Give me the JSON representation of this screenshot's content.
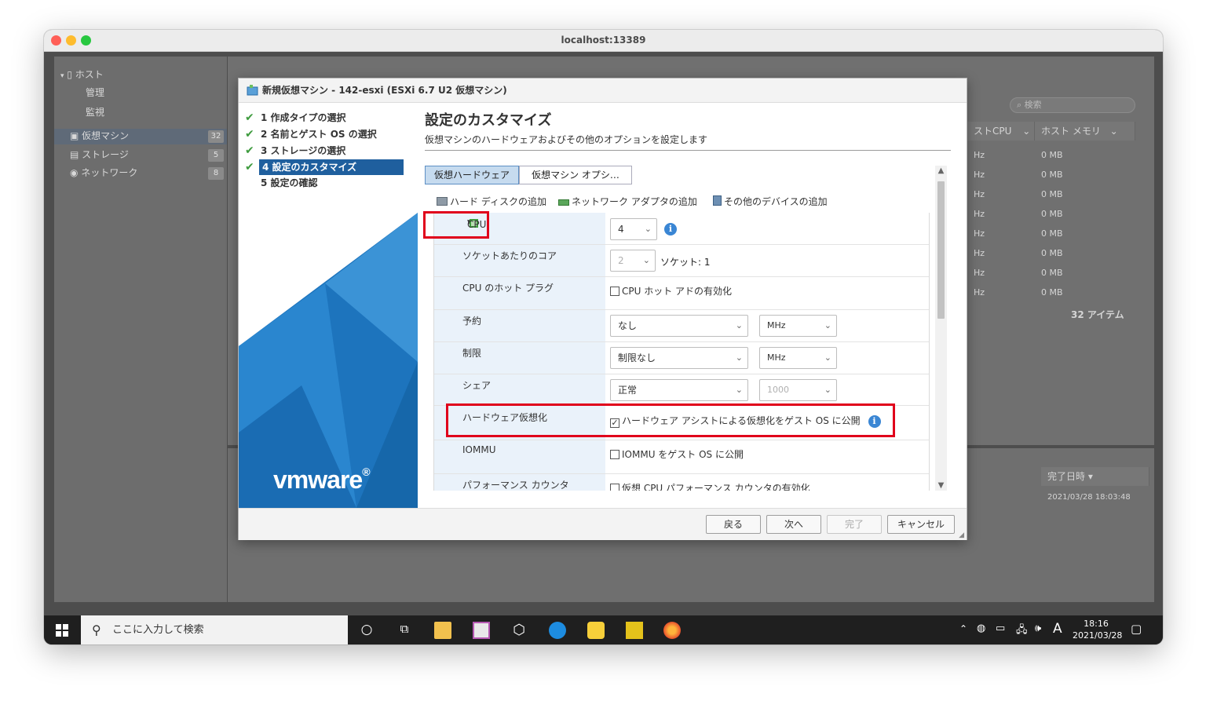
{
  "window": {
    "url": "localhost:13389"
  },
  "background_app": {
    "nav": {
      "host": "ホスト",
      "manage": "管理",
      "monitor": "監視",
      "vms": "仮想マシン",
      "vms_count": "32",
      "storage": "ストレージ",
      "storage_count": "5",
      "network": "ネットワーク",
      "network_count": "8"
    },
    "search_placeholder": "検索",
    "grid": {
      "col_cpu": "ストCPU",
      "col_mem": "ホスト メモリ",
      "cpu_values": [
        "Hz",
        "Hz",
        "Hz",
        "Hz",
        "Hz",
        "Hz",
        "Hz",
        "Hz"
      ],
      "mem_values": [
        "0 MB",
        "0 MB",
        "0 MB",
        "0 MB",
        "0 MB",
        "0 MB",
        "0 MB",
        "0 MB"
      ],
      "item_count": "32 アイテム"
    },
    "tasks": {
      "col_completed": "完了日時 ▾",
      "completed_value": "2021/03/28 18:03:48"
    }
  },
  "dialog": {
    "title": "新規仮想マシン - 142-esxi (ESXi 6.7 U2 仮想マシン)",
    "steps": [
      {
        "label": "1 作成タイプの選択",
        "done": true
      },
      {
        "label": "2 名前とゲスト OS の選択",
        "done": true
      },
      {
        "label": "3 ストレージの選択",
        "done": true
      },
      {
        "label": "4 設定のカスタマイズ",
        "done": true,
        "active": true
      },
      {
        "label": "5 設定の確認",
        "done": false
      }
    ],
    "logo_text": "vmware",
    "heading": "設定のカスタマイズ",
    "subheading": "仮想マシンのハードウェアおよびその他のオプションを設定します",
    "tabs": {
      "hardware": "仮想ハードウェア",
      "options": "仮想マシン オプシ…"
    },
    "actions": {
      "add_disk": "ハード ディスクの追加",
      "add_nic": "ネットワーク アダプタの追加",
      "add_other": "その他のデバイスの追加"
    },
    "cpu": {
      "label": "CPU",
      "count": "4",
      "cores_label": "ソケットあたりのコア",
      "cores": "2",
      "sockets": "ソケット: 1",
      "hotplug_label": "CPU のホット プラグ",
      "hotplug_option": "CPU ホット アドの有効化",
      "hotplug_checked": false,
      "reservation_label": "予約",
      "reservation": "なし",
      "reservation_unit": "MHz",
      "limit_label": "制限",
      "limit": "制限なし",
      "limit_unit": "MHz",
      "shares_label": "シェア",
      "shares": "正常",
      "shares_value": "1000",
      "hv_label": "ハードウェア仮想化",
      "hv_option": "ハードウェア アシストによる仮想化をゲスト OS に公開",
      "hv_checked": true,
      "iommu_label": "IOMMU",
      "iommu_option": "IOMMU をゲスト OS に公開",
      "iommu_checked": false,
      "perf_label": "パフォーマンス カウンタ",
      "perf_option": "仮想 CPU パフォーマンス カウンタの有効化",
      "perf_checked": false
    },
    "buttons": {
      "back": "戻る",
      "next": "次へ",
      "finish": "完了",
      "cancel": "キャンセル"
    }
  },
  "taskbar": {
    "search_placeholder": "ここに入力して検索",
    "ime": "A",
    "time": "18:16",
    "date": "2021/03/28"
  }
}
